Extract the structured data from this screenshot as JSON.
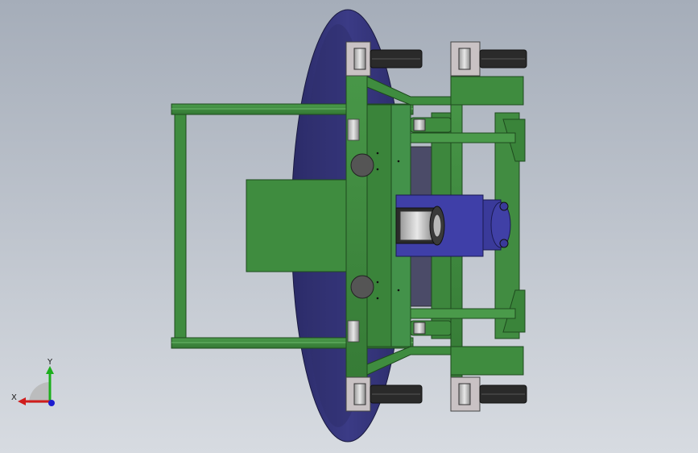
{
  "viewport": {
    "background_top": "#a5adb9",
    "background_bottom": "#d7dbe1"
  },
  "model": {
    "frame_color": "#3e8a3e",
    "frame_dark": "#1e4a1e",
    "disc_color": "#34347a",
    "motor_color": "#3f3fa8",
    "wheel_color": "#2a2a2a",
    "caster_plate_color": "#c9c2c4"
  },
  "triad": {
    "x_label": "X",
    "y_label": "Y",
    "x_color": "#d01c1c",
    "y_color": "#1cae1c",
    "z_color": "#1c1cd0"
  }
}
